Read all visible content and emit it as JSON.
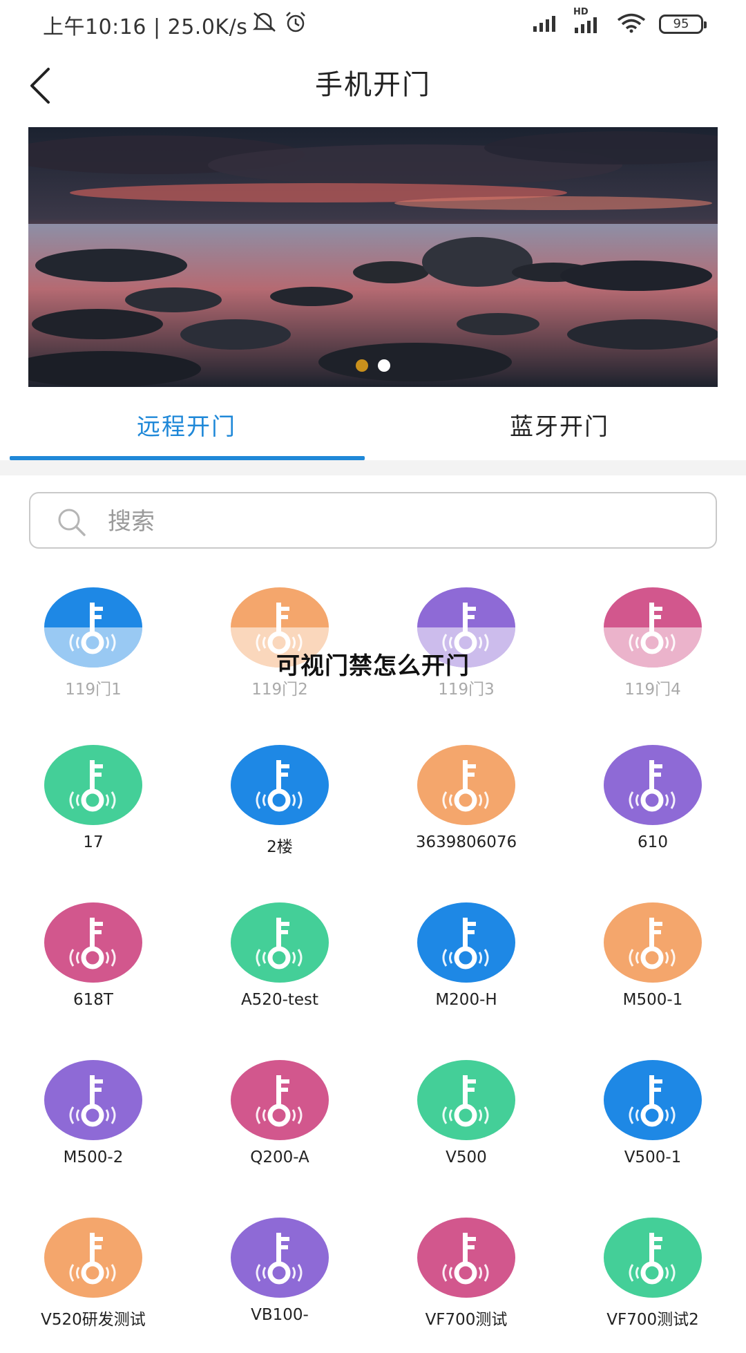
{
  "status_bar": {
    "time_speed": "上午10:16 | 25.0K/s",
    "battery": "95",
    "network_badge": "HD"
  },
  "header": {
    "title": "手机开门",
    "back_icon": "chevron-left-icon"
  },
  "banner": {
    "slide_count": 2,
    "active_slide": 1
  },
  "tabs": [
    {
      "label": "远程开门",
      "active": true
    },
    {
      "label": "蓝牙开门",
      "active": false
    }
  ],
  "search": {
    "placeholder": "搜索",
    "value": ""
  },
  "doors": [
    {
      "label": "119门1",
      "color": "#1e88e5",
      "faded": true
    },
    {
      "label": "119门2",
      "color": "#f4a66c",
      "faded": true
    },
    {
      "label": "119门3",
      "color": "#8e6ad6",
      "faded": true
    },
    {
      "label": "119门4",
      "color": "#d2578d",
      "faded": true
    },
    {
      "label": "17",
      "color": "#44cf98",
      "faded": false
    },
    {
      "label": "2楼",
      "color": "#1e88e5",
      "faded": false
    },
    {
      "label": "3639806076",
      "color": "#f4a66c",
      "faded": false
    },
    {
      "label": "610",
      "color": "#8e6ad6",
      "faded": false
    },
    {
      "label": "618T",
      "color": "#d2578d",
      "faded": false
    },
    {
      "label": "A520-test",
      "color": "#44cf98",
      "faded": false
    },
    {
      "label": "M200-H",
      "color": "#1e88e5",
      "faded": false
    },
    {
      "label": "M500-1",
      "color": "#f4a66c",
      "faded": false
    },
    {
      "label": "M500-2",
      "color": "#8e6ad6",
      "faded": false
    },
    {
      "label": "Q200-A",
      "color": "#d2578d",
      "faded": false
    },
    {
      "label": "V500",
      "color": "#44cf98",
      "faded": false
    },
    {
      "label": "V500-1",
      "color": "#1e88e5",
      "faded": false
    },
    {
      "label": "V520研发测试",
      "color": "#f4a66c",
      "faded": false
    },
    {
      "label": "VB100-",
      "color": "#8e6ad6",
      "faded": false
    },
    {
      "label": "VF700测试",
      "color": "#d2578d",
      "faded": false
    },
    {
      "label": "VF700测试2",
      "color": "#44cf98",
      "faded": false
    }
  ],
  "overlay_text": "可视门禁怎么开门",
  "colors": {
    "accent": "#1f88d8",
    "banner_dot_active": "#c9901c"
  }
}
